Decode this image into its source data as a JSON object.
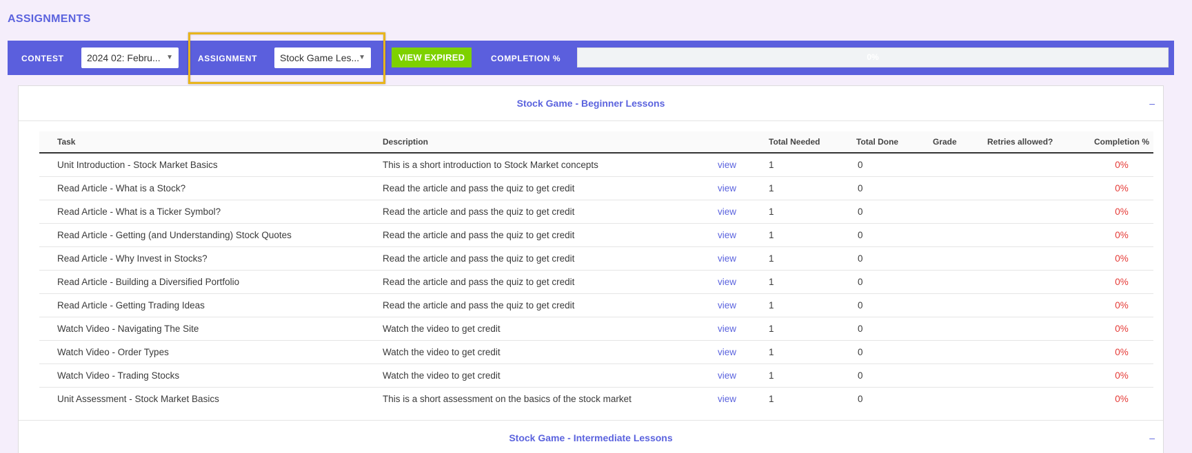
{
  "page": {
    "title": "ASSIGNMENTS"
  },
  "toolbar": {
    "contest_label": "CONTEST",
    "contest_value": "2024 02: Febru...",
    "assignment_label": "ASSIGNMENT",
    "assignment_value": "Stock Game Les...",
    "view_expired_label": "VIEW EXPIRED",
    "completion_label": "COMPLETION %",
    "completion_value": "0%",
    "completion_fraction": 0
  },
  "colors": {
    "accent": "#5b5fdd",
    "button_green": "#7ed100",
    "highlight": "#e8b51d",
    "percent_red": "#e53935"
  },
  "sections": [
    {
      "title": "Stock Game - Beginner Lessons",
      "toggle": "–"
    },
    {
      "title": "Stock Game - Intermediate Lessons",
      "toggle": "–"
    }
  ],
  "table": {
    "headers": [
      "Task",
      "Description",
      "",
      "Total Needed",
      "Total Done",
      "Grade",
      "Retries allowed?",
      "Completion %"
    ],
    "rows": [
      {
        "task": "Unit Introduction - Stock Market Basics",
        "description": "This is a short introduction to Stock Market concepts",
        "link": "view",
        "needed": "1",
        "done": "0",
        "grade": "",
        "retries": "",
        "completion": "0%"
      },
      {
        "task": "Read Article - What is a Stock?",
        "description": "Read the article and pass the quiz to get credit",
        "link": "view",
        "needed": "1",
        "done": "0",
        "grade": "",
        "retries": "",
        "completion": "0%"
      },
      {
        "task": "Read Article - What is a Ticker Symbol?",
        "description": "Read the article and pass the quiz to get credit",
        "link": "view",
        "needed": "1",
        "done": "0",
        "grade": "",
        "retries": "",
        "completion": "0%"
      },
      {
        "task": "Read Article - Getting (and Understanding) Stock Quotes",
        "description": "Read the article and pass the quiz to get credit",
        "link": "view",
        "needed": "1",
        "done": "0",
        "grade": "",
        "retries": "",
        "completion": "0%"
      },
      {
        "task": "Read Article - Why Invest in Stocks?",
        "description": "Read the article and pass the quiz to get credit",
        "link": "view",
        "needed": "1",
        "done": "0",
        "grade": "",
        "retries": "",
        "completion": "0%"
      },
      {
        "task": "Read Article - Building a Diversified Portfolio",
        "description": "Read the article and pass the quiz to get credit",
        "link": "view",
        "needed": "1",
        "done": "0",
        "grade": "",
        "retries": "",
        "completion": "0%"
      },
      {
        "task": "Read Article - Getting Trading Ideas",
        "description": "Read the article and pass the quiz to get credit",
        "link": "view",
        "needed": "1",
        "done": "0",
        "grade": "",
        "retries": "",
        "completion": "0%"
      },
      {
        "task": "Watch Video - Navigating The Site",
        "description": "Watch the video to get credit",
        "link": "view",
        "needed": "1",
        "done": "0",
        "grade": "",
        "retries": "",
        "completion": "0%"
      },
      {
        "task": "Watch Video - Order Types",
        "description": "Watch the video to get credit",
        "link": "view",
        "needed": "1",
        "done": "0",
        "grade": "",
        "retries": "",
        "completion": "0%"
      },
      {
        "task": "Watch Video - Trading Stocks",
        "description": "Watch the video to get credit",
        "link": "view",
        "needed": "1",
        "done": "0",
        "grade": "",
        "retries": "",
        "completion": "0%"
      },
      {
        "task": "Unit Assessment - Stock Market Basics",
        "description": "This is a short assessment on the basics of the stock market",
        "link": "view",
        "needed": "1",
        "done": "0",
        "grade": "",
        "retries": "",
        "completion": "0%"
      }
    ]
  }
}
